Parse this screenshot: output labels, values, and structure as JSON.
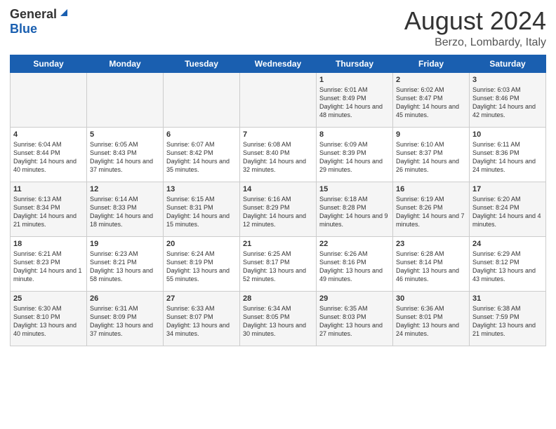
{
  "header": {
    "logo_general": "General",
    "logo_blue": "Blue",
    "title": "August 2024",
    "location": "Berzo, Lombardy, Italy"
  },
  "weekdays": [
    "Sunday",
    "Monday",
    "Tuesday",
    "Wednesday",
    "Thursday",
    "Friday",
    "Saturday"
  ],
  "weeks": [
    [
      {
        "day": "",
        "sunrise": "",
        "sunset": "",
        "daylight": ""
      },
      {
        "day": "",
        "sunrise": "",
        "sunset": "",
        "daylight": ""
      },
      {
        "day": "",
        "sunrise": "",
        "sunset": "",
        "daylight": ""
      },
      {
        "day": "",
        "sunrise": "",
        "sunset": "",
        "daylight": ""
      },
      {
        "day": "1",
        "sunrise": "Sunrise: 6:01 AM",
        "sunset": "Sunset: 8:49 PM",
        "daylight": "Daylight: 14 hours and 48 minutes."
      },
      {
        "day": "2",
        "sunrise": "Sunrise: 6:02 AM",
        "sunset": "Sunset: 8:47 PM",
        "daylight": "Daylight: 14 hours and 45 minutes."
      },
      {
        "day": "3",
        "sunrise": "Sunrise: 6:03 AM",
        "sunset": "Sunset: 8:46 PM",
        "daylight": "Daylight: 14 hours and 42 minutes."
      }
    ],
    [
      {
        "day": "4",
        "sunrise": "Sunrise: 6:04 AM",
        "sunset": "Sunset: 8:44 PM",
        "daylight": "Daylight: 14 hours and 40 minutes."
      },
      {
        "day": "5",
        "sunrise": "Sunrise: 6:05 AM",
        "sunset": "Sunset: 8:43 PM",
        "daylight": "Daylight: 14 hours and 37 minutes."
      },
      {
        "day": "6",
        "sunrise": "Sunrise: 6:07 AM",
        "sunset": "Sunset: 8:42 PM",
        "daylight": "Daylight: 14 hours and 35 minutes."
      },
      {
        "day": "7",
        "sunrise": "Sunrise: 6:08 AM",
        "sunset": "Sunset: 8:40 PM",
        "daylight": "Daylight: 14 hours and 32 minutes."
      },
      {
        "day": "8",
        "sunrise": "Sunrise: 6:09 AM",
        "sunset": "Sunset: 8:39 PM",
        "daylight": "Daylight: 14 hours and 29 minutes."
      },
      {
        "day": "9",
        "sunrise": "Sunrise: 6:10 AM",
        "sunset": "Sunset: 8:37 PM",
        "daylight": "Daylight: 14 hours and 26 minutes."
      },
      {
        "day": "10",
        "sunrise": "Sunrise: 6:11 AM",
        "sunset": "Sunset: 8:36 PM",
        "daylight": "Daylight: 14 hours and 24 minutes."
      }
    ],
    [
      {
        "day": "11",
        "sunrise": "Sunrise: 6:13 AM",
        "sunset": "Sunset: 8:34 PM",
        "daylight": "Daylight: 14 hours and 21 minutes."
      },
      {
        "day": "12",
        "sunrise": "Sunrise: 6:14 AM",
        "sunset": "Sunset: 8:33 PM",
        "daylight": "Daylight: 14 hours and 18 minutes."
      },
      {
        "day": "13",
        "sunrise": "Sunrise: 6:15 AM",
        "sunset": "Sunset: 8:31 PM",
        "daylight": "Daylight: 14 hours and 15 minutes."
      },
      {
        "day": "14",
        "sunrise": "Sunrise: 6:16 AM",
        "sunset": "Sunset: 8:29 PM",
        "daylight": "Daylight: 14 hours and 12 minutes."
      },
      {
        "day": "15",
        "sunrise": "Sunrise: 6:18 AM",
        "sunset": "Sunset: 8:28 PM",
        "daylight": "Daylight: 14 hours and 9 minutes."
      },
      {
        "day": "16",
        "sunrise": "Sunrise: 6:19 AM",
        "sunset": "Sunset: 8:26 PM",
        "daylight": "Daylight: 14 hours and 7 minutes."
      },
      {
        "day": "17",
        "sunrise": "Sunrise: 6:20 AM",
        "sunset": "Sunset: 8:24 PM",
        "daylight": "Daylight: 14 hours and 4 minutes."
      }
    ],
    [
      {
        "day": "18",
        "sunrise": "Sunrise: 6:21 AM",
        "sunset": "Sunset: 8:23 PM",
        "daylight": "Daylight: 14 hours and 1 minute."
      },
      {
        "day": "19",
        "sunrise": "Sunrise: 6:23 AM",
        "sunset": "Sunset: 8:21 PM",
        "daylight": "Daylight: 13 hours and 58 minutes."
      },
      {
        "day": "20",
        "sunrise": "Sunrise: 6:24 AM",
        "sunset": "Sunset: 8:19 PM",
        "daylight": "Daylight: 13 hours and 55 minutes."
      },
      {
        "day": "21",
        "sunrise": "Sunrise: 6:25 AM",
        "sunset": "Sunset: 8:17 PM",
        "daylight": "Daylight: 13 hours and 52 minutes."
      },
      {
        "day": "22",
        "sunrise": "Sunrise: 6:26 AM",
        "sunset": "Sunset: 8:16 PM",
        "daylight": "Daylight: 13 hours and 49 minutes."
      },
      {
        "day": "23",
        "sunrise": "Sunrise: 6:28 AM",
        "sunset": "Sunset: 8:14 PM",
        "daylight": "Daylight: 13 hours and 46 minutes."
      },
      {
        "day": "24",
        "sunrise": "Sunrise: 6:29 AM",
        "sunset": "Sunset: 8:12 PM",
        "daylight": "Daylight: 13 hours and 43 minutes."
      }
    ],
    [
      {
        "day": "25",
        "sunrise": "Sunrise: 6:30 AM",
        "sunset": "Sunset: 8:10 PM",
        "daylight": "Daylight: 13 hours and 40 minutes."
      },
      {
        "day": "26",
        "sunrise": "Sunrise: 6:31 AM",
        "sunset": "Sunset: 8:09 PM",
        "daylight": "Daylight: 13 hours and 37 minutes."
      },
      {
        "day": "27",
        "sunrise": "Sunrise: 6:33 AM",
        "sunset": "Sunset: 8:07 PM",
        "daylight": "Daylight: 13 hours and 34 minutes."
      },
      {
        "day": "28",
        "sunrise": "Sunrise: 6:34 AM",
        "sunset": "Sunset: 8:05 PM",
        "daylight": "Daylight: 13 hours and 30 minutes."
      },
      {
        "day": "29",
        "sunrise": "Sunrise: 6:35 AM",
        "sunset": "Sunset: 8:03 PM",
        "daylight": "Daylight: 13 hours and 27 minutes."
      },
      {
        "day": "30",
        "sunrise": "Sunrise: 6:36 AM",
        "sunset": "Sunset: 8:01 PM",
        "daylight": "Daylight: 13 hours and 24 minutes."
      },
      {
        "day": "31",
        "sunrise": "Sunrise: 6:38 AM",
        "sunset": "Sunset: 7:59 PM",
        "daylight": "Daylight: 13 hours and 21 minutes."
      }
    ]
  ]
}
